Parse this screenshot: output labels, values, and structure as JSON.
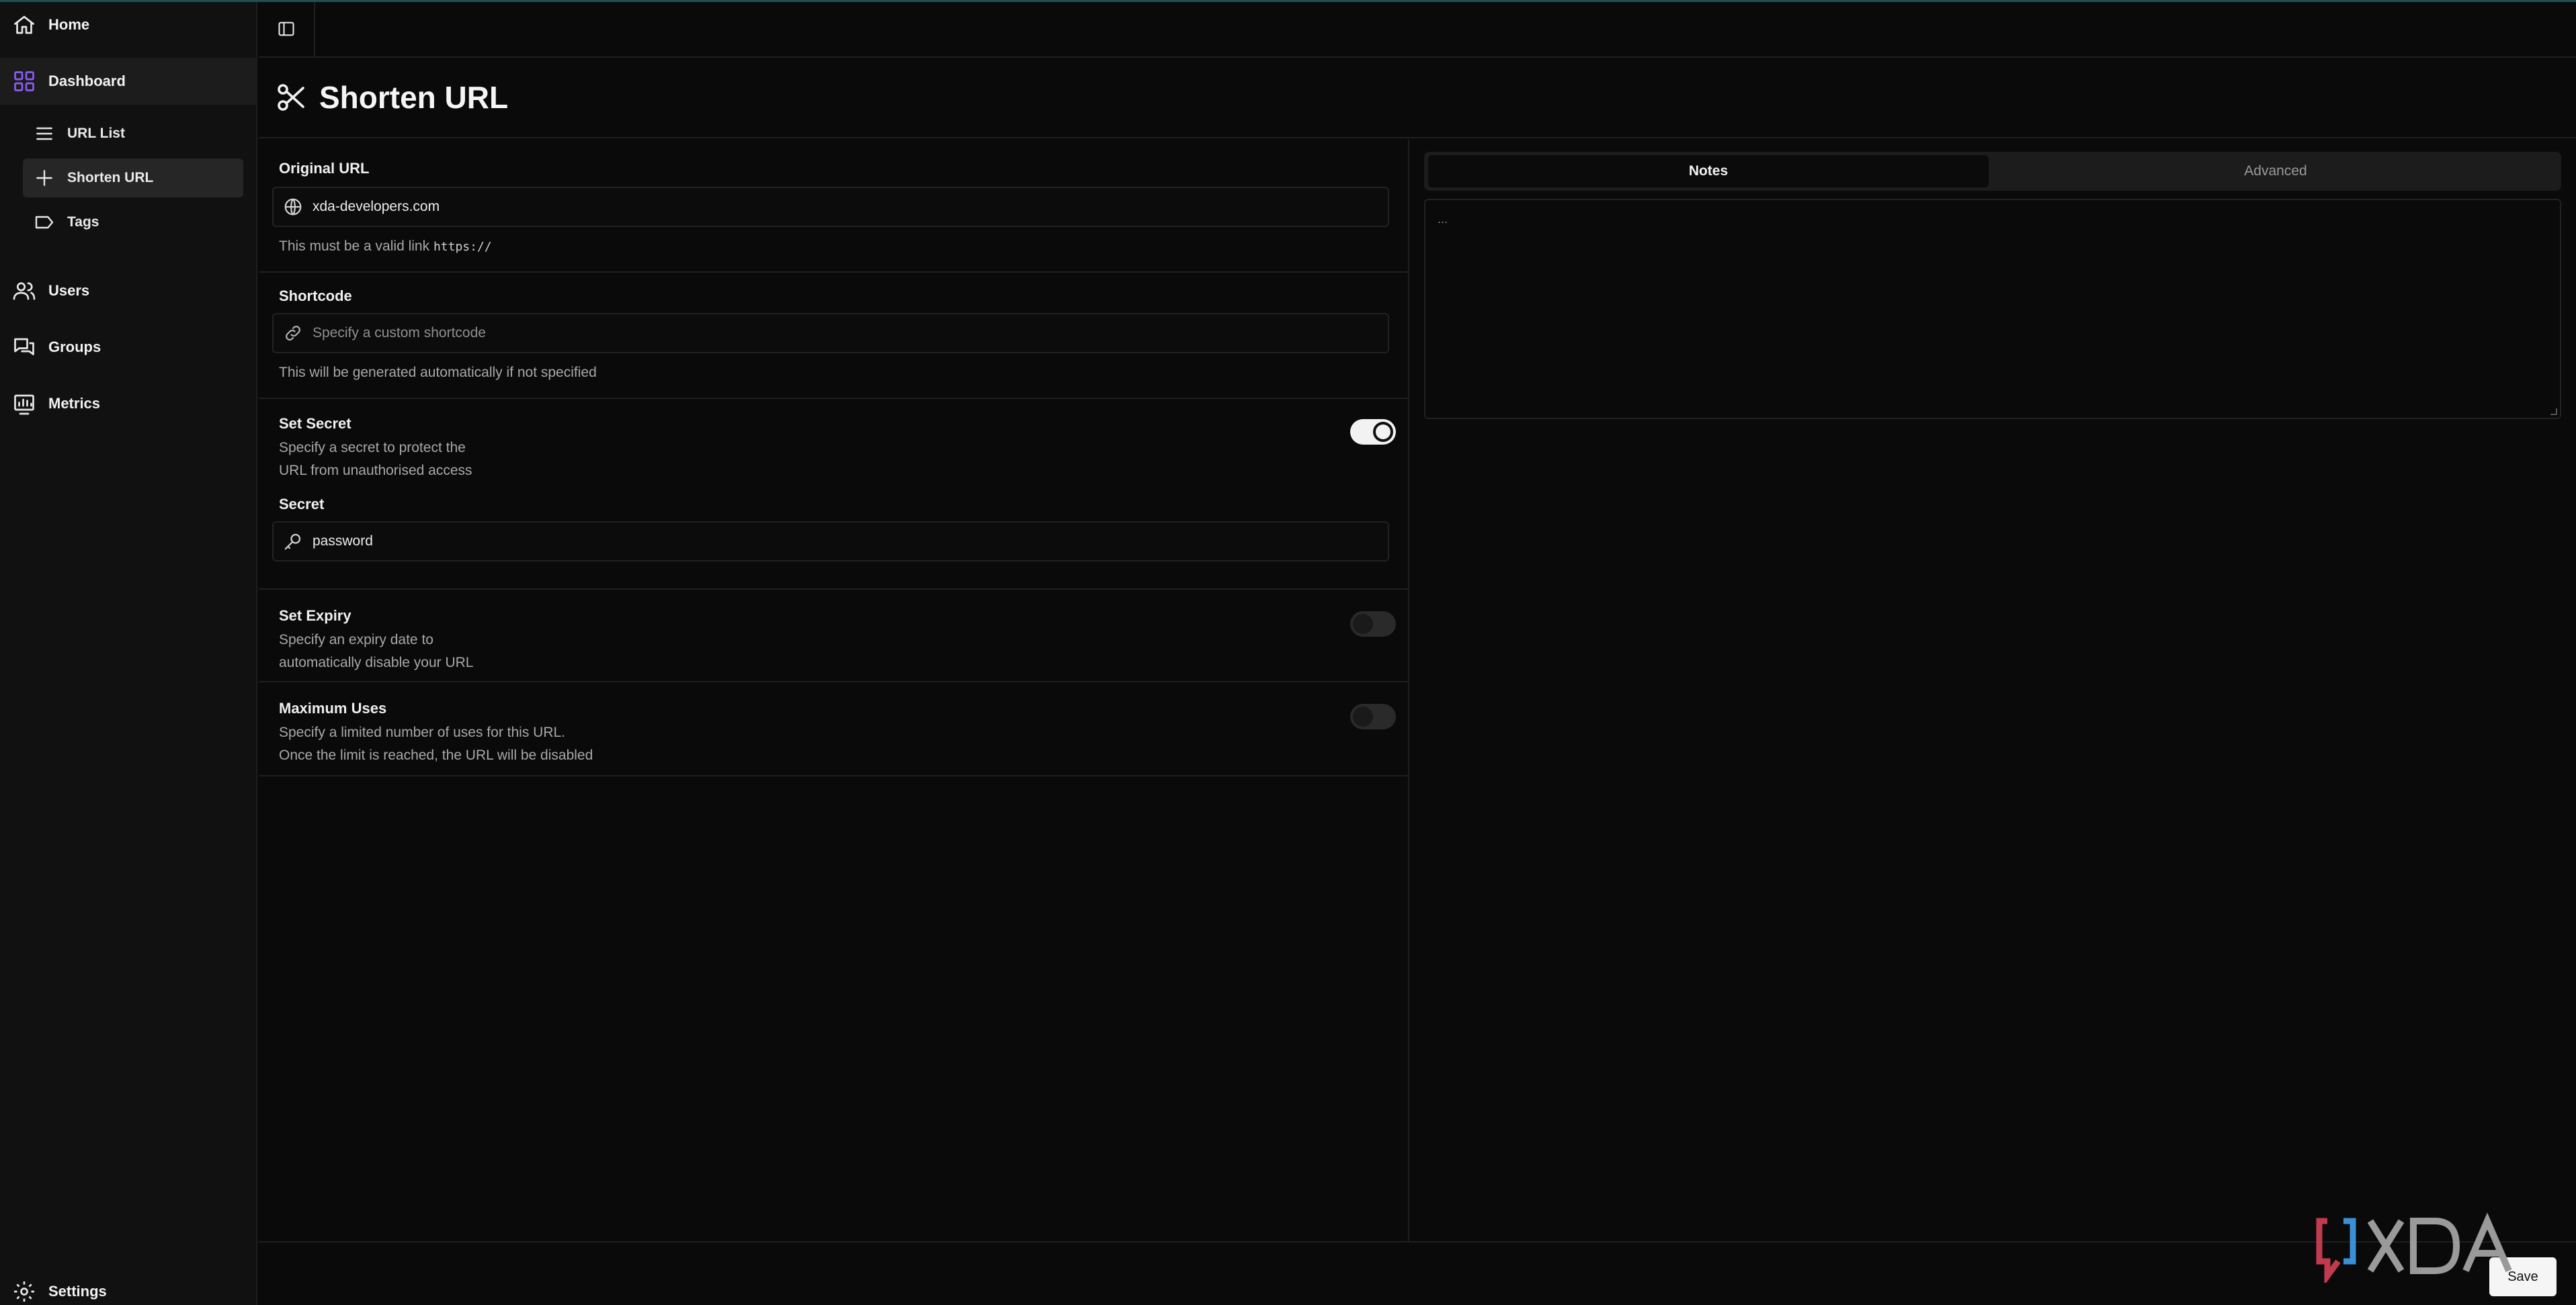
{
  "sidebar": {
    "home": "Home",
    "dashboard": "Dashboard",
    "sub_items": [
      {
        "label": "URL List"
      },
      {
        "label": "Shorten URL"
      },
      {
        "label": "Tags"
      }
    ],
    "users": "Users",
    "groups": "Groups",
    "metrics": "Metrics",
    "settings": "Settings"
  },
  "page": {
    "title": "Shorten URL"
  },
  "form": {
    "original_url": {
      "label": "Original URL",
      "value": "xda-developers.com",
      "help_prefix": "This must be a valid link",
      "help_code": "https://"
    },
    "shortcode": {
      "label": "Shortcode",
      "placeholder": "Specify a custom shortcode",
      "help": "This will be generated automatically if not specified"
    },
    "set_secret": {
      "label": "Set Secret",
      "desc_line1": "Specify a secret to protect the",
      "desc_line2": "URL from unauthorised access",
      "enabled": true,
      "secret_label": "Secret",
      "secret_value": "password"
    },
    "set_expiry": {
      "label": "Set Expiry",
      "desc_line1": "Specify an expiry date to",
      "desc_line2": "automatically disable your URL",
      "enabled": false
    },
    "maximum_uses": {
      "label": "Maximum Uses",
      "desc_line1": "Specify a limited number of uses for this URL.",
      "desc_line2": "Once the limit is reached, the URL will be disabled",
      "enabled": false
    }
  },
  "tabs": {
    "notes": "Notes",
    "advanced": "Advanced",
    "active": "Notes"
  },
  "notes": {
    "placeholder": "..."
  },
  "footer": {
    "save": "Save"
  },
  "colors": {
    "accent_purple": "#8b5cf6",
    "background": "#0a0a0a",
    "sidebar": "#111111"
  }
}
